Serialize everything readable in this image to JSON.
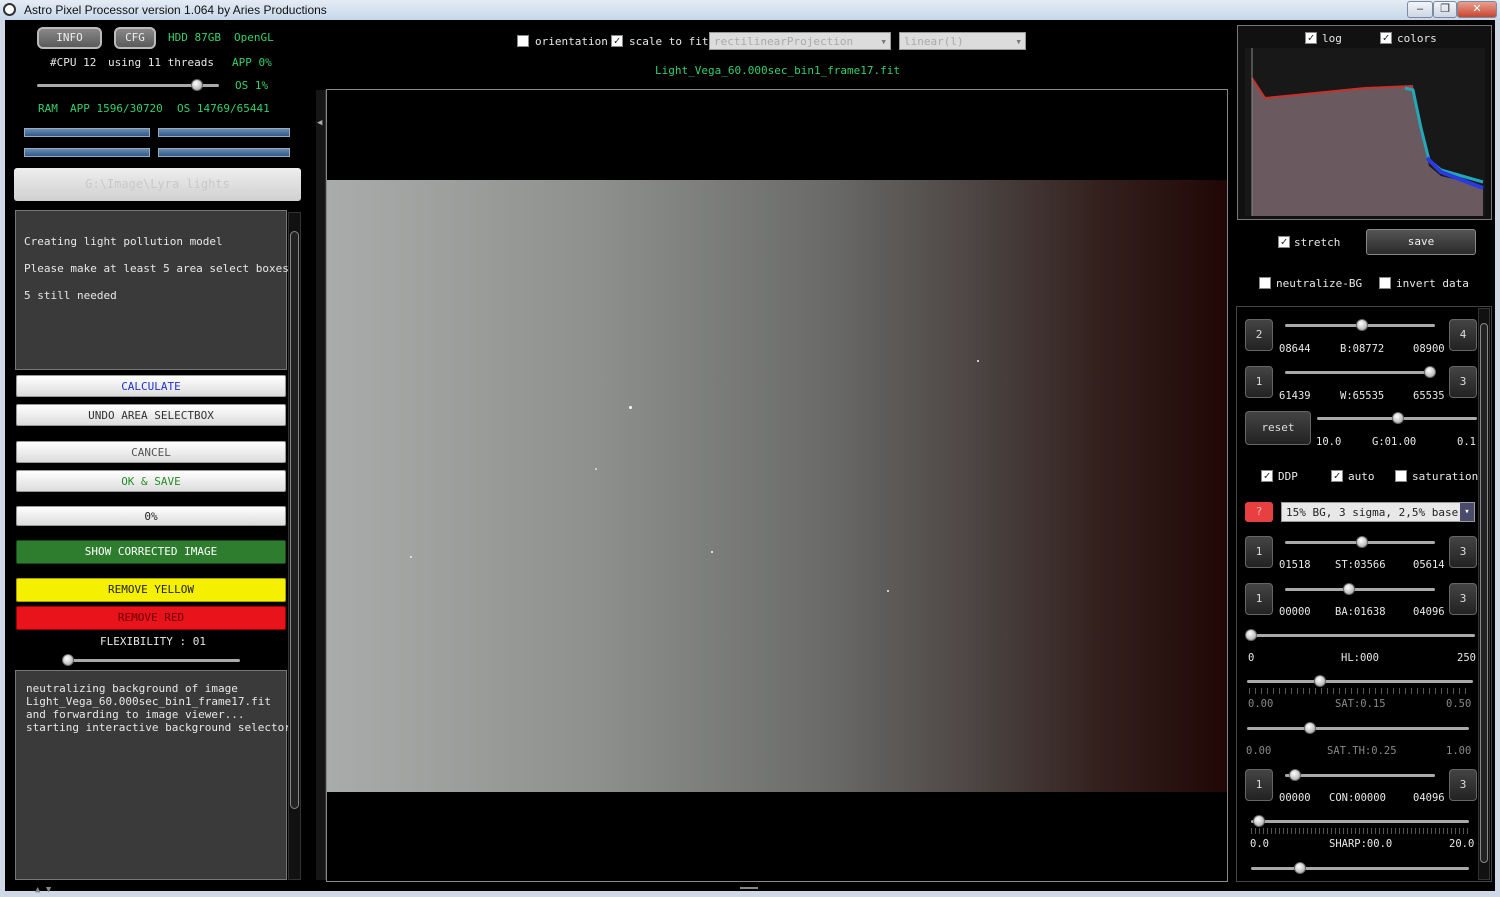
{
  "window": {
    "title": "Astro Pixel Processor version 1.064 by Aries Productions",
    "min": "–",
    "max": "❐",
    "close": "✕"
  },
  "status": {
    "info_tab": "INFO",
    "cfg_tab": "CFG",
    "hdd": "HDD 87GB",
    "opengl": "OpenGL",
    "cpu": "#CPU 12",
    "threads": "using 11 threads",
    "app_cpu": "APP 0%",
    "os_cpu": "OS 1%",
    "ram_label": "RAM",
    "ram_app": "APP 1596/30720",
    "ram_os": "OS 14769/65441",
    "thread_slider": 0.8
  },
  "path": "G:\\Image\\Lyra lights",
  "message": {
    "line1": "Creating light pollution model",
    "line2": "Please make at least 5 area select boxes",
    "line3": "5 still needed"
  },
  "buttons": {
    "calculate": "CALCULATE",
    "undo": "UNDO AREA SELECTBOX",
    "cancel": "CANCEL",
    "ok_save": "OK & SAVE",
    "progress": "0%",
    "show_corrected": "SHOW CORRECTED IMAGE",
    "remove_yellow": "REMOVE YELLOW",
    "remove_red": "REMOVE RED",
    "flexibility": "FLEXIBILITY : 01"
  },
  "log": {
    "l1": "neutralizing background of image",
    "l2": "Light_Vega_60.000sec_bin1_frame17.fit",
    "l3": "and forwarding to image viewer...",
    "l4": "starting interactive background selector."
  },
  "viewer": {
    "orientation": "orientation",
    "scale_to_fit": "scale to fit",
    "projection": "rectilinearProjection",
    "stretch_mode": "linear(l)",
    "filename": "Light_Vega_60.000sec_bin1_frame17.fit"
  },
  "right": {
    "log": "log",
    "colors": "colors",
    "stretch": "stretch",
    "save": "save",
    "neutralize": "neutralize-BG",
    "invert": "invert data",
    "b_btn_left": "2",
    "b_btn_right": "4",
    "b_min": "08644",
    "b_val": "B:08772",
    "b_max": "08900",
    "w_btn_left": "1",
    "w_btn_right": "3",
    "w_min": "61439",
    "w_val": "W:65535",
    "w_max": "65535",
    "reset": "reset",
    "g_min": "10.0",
    "g_val": "G:01.00",
    "g_max": "0.1",
    "ddp": "DDP",
    "auto": "auto",
    "saturation": "saturation",
    "preset_help": "?",
    "preset": "15% BG, 3 sigma, 2,5% base",
    "st_btn_left": "1",
    "st_btn_right": "3",
    "st_min": "01518",
    "st_val": "ST:03566",
    "st_max": "05614",
    "ba_btn_left": "1",
    "ba_btn_right": "3",
    "ba_min": "00000",
    "ba_val": "BA:01638",
    "ba_max": "04096",
    "hl_min": "0",
    "hl_val": "HL:000",
    "hl_max": "250",
    "sat_min": "0.00",
    "sat_val": "SAT:0.15",
    "sat_max": "0.50",
    "satth_min": "0.00",
    "satth_val": "SAT.TH:0.25",
    "satth_max": "1.00",
    "con_btn_left": "1",
    "con_btn_right": "3",
    "con_min": "00000",
    "con_val": "CON:00000",
    "con_max": "04096",
    "sharp_min": "0.0",
    "sharp_val": "SHARP:00.0",
    "sharp_max": "20.0"
  },
  "colors": {
    "green_btn": "#2e7d2e",
    "yellow_btn": "#f5f000",
    "red_btn": "#e8131b",
    "status_green": "#33d06a"
  }
}
